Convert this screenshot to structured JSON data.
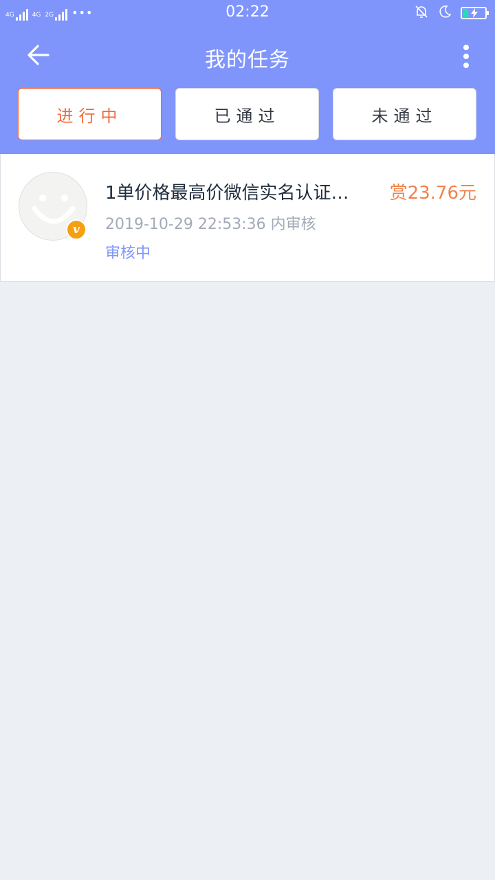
{
  "status_bar": {
    "net1": "4G",
    "net2": "4G",
    "net3": "2G",
    "more": "•••",
    "time": "02:22",
    "icons": [
      "bell-off-icon",
      "moon-icon",
      "battery-charging-icon"
    ],
    "battery_level": 0.25
  },
  "nav": {
    "title": "我的任务",
    "back_icon": "arrow-left-icon",
    "more_icon": "more-vertical-icon"
  },
  "tabs": [
    {
      "label": "进行中",
      "active": true
    },
    {
      "label": "已通过",
      "active": false
    },
    {
      "label": "未通过",
      "active": false
    }
  ],
  "tasks": [
    {
      "avatar_icon": "smiley-avatar-icon",
      "badge": "v",
      "title": "1单价格最高价微信实名认证…",
      "reward": "赏23.76元",
      "time": "2019-10-29 22:53:36 内审核",
      "status": "审核中"
    }
  ],
  "colors": {
    "header": "#7f95fc",
    "active_tab": "#f36a3b",
    "reward": "#f0824a",
    "status": "#7f95fc",
    "background": "#ecf0f5"
  }
}
